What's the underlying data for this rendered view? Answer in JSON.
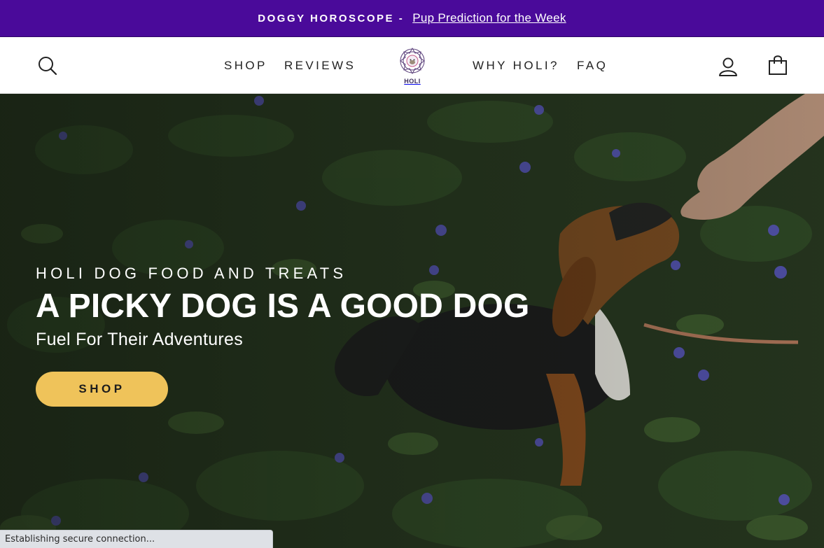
{
  "announcement": {
    "lead": "DOGGY HOROSCOPE -",
    "link": "Pup Prediction for the Week"
  },
  "header": {
    "nav_left": [
      "SHOP",
      "REVIEWS"
    ],
    "nav_right": [
      "WHY HOLI?",
      "FAQ"
    ],
    "logo_text": "HOLI",
    "icons": [
      "search-icon",
      "account-icon",
      "cart-icon"
    ]
  },
  "hero": {
    "eyebrow": "HOLI DOG FOOD AND TREATS",
    "headline": "A PICKY DOG IS A GOOD DOG",
    "subhead": "Fuel For Their Adventures",
    "cta_label": "SHOP"
  },
  "browser_status": "Establishing secure connection...",
  "colors": {
    "announcement_bg": "#4a0a9a",
    "cta_bg": "#efc35a",
    "text_dark": "#222222"
  }
}
